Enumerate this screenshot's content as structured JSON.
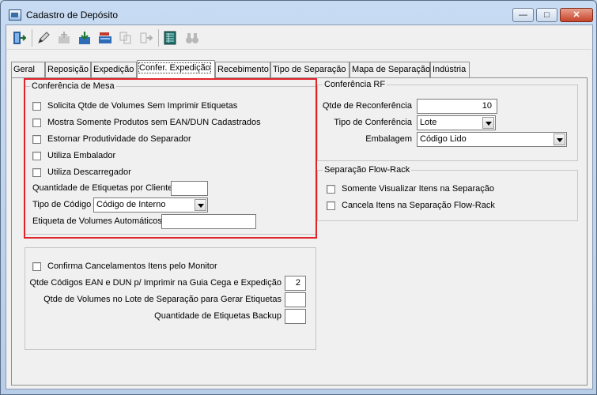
{
  "window": {
    "title": "Cadastro de Depósito"
  },
  "toolbar": {
    "icons": [
      "exit-icon",
      "edit-icon",
      "add-icon",
      "save-icon",
      "open-icon",
      "copy-icon",
      "move-icon",
      "table-icon",
      "binoculars-icon"
    ]
  },
  "tabs": [
    "Geral",
    "Reposição",
    "Expedição",
    "Confer. Expedição",
    "Recebimento",
    "Tipo de Separação",
    "Mapa de Separação",
    "Indústria"
  ],
  "conferencia_mesa": {
    "legend": "Conferência de Mesa",
    "checkboxes": [
      "Solicita Qtde de Volumes Sem Imprimir Etiquetas",
      "Mostra Somente Produtos sem EAN/DUN Cadastrados",
      "Estornar Produtividade do Separador",
      "Utiliza Embalador",
      "Utiliza Descarregador"
    ],
    "qtd_etiquetas_label": "Quantidade de Etiquetas por Cliente",
    "qtd_etiquetas_value": "",
    "tipo_codigo_label": "Tipo de Código",
    "tipo_codigo_value": "Código de Interno",
    "etiqueta_volumes_label": "Etiqueta de Volumes Automáticos",
    "etiqueta_volumes_value": ""
  },
  "conferencia_rf": {
    "legend": "Conferência RF",
    "qtde_reconf_label": "Qtde de Reconferência",
    "qtde_reconf_value": "10",
    "tipo_conf_label": "Tipo de Conferência",
    "tipo_conf_value": "Lote",
    "embalagem_label": "Embalagem",
    "embalagem_value": "Código Lido"
  },
  "flow_rack": {
    "legend": "Separação Flow-Rack",
    "checkboxes": [
      "Somente Visualizar Itens na Separação",
      "Cancela Itens na Separação Flow-Rack"
    ]
  },
  "bottom_group": {
    "checkbox": "Confirma Cancelamentos Itens pelo Monitor",
    "ean_dun_label": "Qtde Códigos EAN e DUN p/ Imprimir na Guia Cega e Expedição",
    "ean_dun_value": "2",
    "volumes_lote_label": "Qtde de Volumes no Lote de Separação para Gerar Etiquetas",
    "volumes_lote_value": "",
    "backup_label": "Quantidade de Etiquetas Backup",
    "backup_value": ""
  }
}
